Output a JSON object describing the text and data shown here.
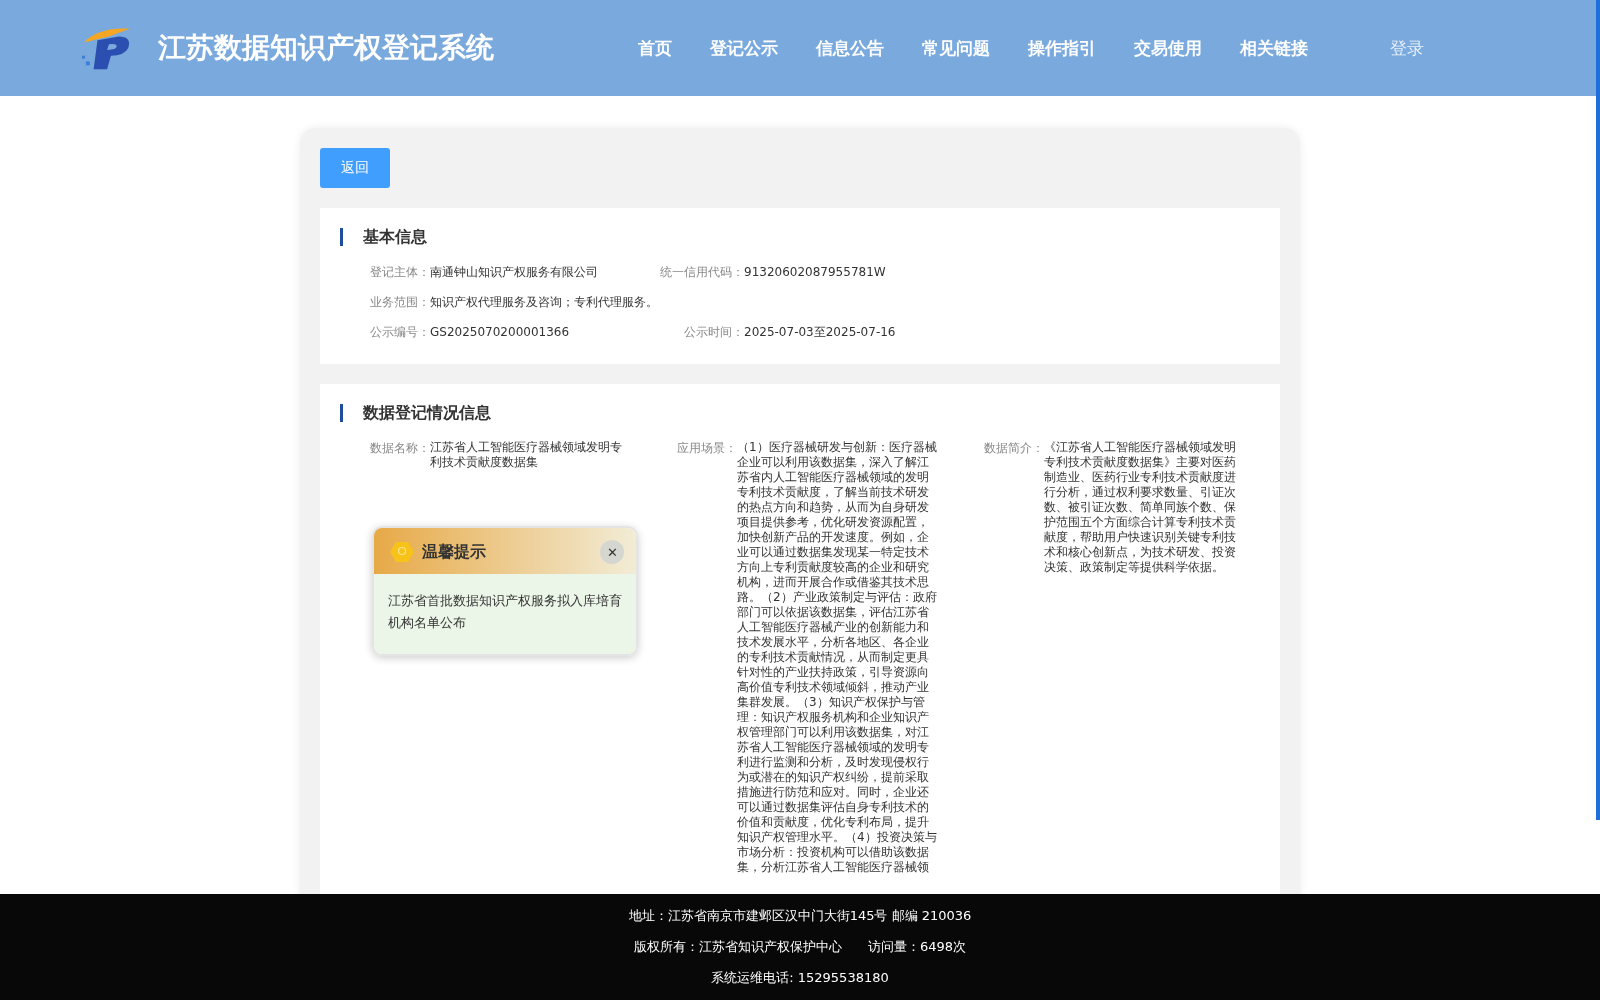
{
  "header": {
    "title": "江苏数据知识产权登记系统",
    "nav": [
      "首页",
      "登记公示",
      "信息公告",
      "常见问题",
      "操作指引",
      "交易使用",
      "相关链接"
    ],
    "login": "登录"
  },
  "back_button": "返回",
  "basic_info": {
    "title": "基本信息",
    "rows": [
      [
        {
          "label": "登记主体：",
          "value": "南通钟山知识产权服务有限公司"
        },
        {
          "label": "统一信用代码：",
          "value": "91320602087955781W"
        }
      ],
      [
        {
          "label": "业务范围：",
          "value": "知识产权代理服务及咨询；专利代理服务。"
        }
      ],
      [
        {
          "label": "公示编号：",
          "value": "GS2025070200001366"
        },
        {
          "label": "公示时间：",
          "value": "2025-07-03至2025-07-16"
        }
      ]
    ]
  },
  "data_info": {
    "title": "数据登记情况信息",
    "fields": [
      {
        "label": "数据名称：",
        "value": "江苏省人工智能医疗器械领域发明专利技术贡献度数据集"
      },
      {
        "label": "应用场景：",
        "value": "（1）医疗器械研发与创新：医疗器械企业可以利用该数据集，深入了解江苏省内人工智能医疗器械领域的发明专利技术贡献度，了解当前技术研发的热点方向和趋势，从而为自身研发项目提供参考，优化研发资源配置，加快创新产品的开发速度。例如，企业可以通过数据集发现某一特定技术方向上专利贡献度较高的企业和研究机构，进而开展合作或借鉴其技术思路。（2）产业政策制定与评估：政府部门可以依据该数据集，评估江苏省人工智能医疗器械产业的创新能力和技术发展水平，分析各地区、各企业的专利技术贡献情况，从而制定更具针对性的产业扶持政策，引导资源向高价值专利技术领域倾斜，推动产业集群发展。（3）知识产权保护与管理：知识产权服务机构和企业知识产权管理部门可以利用该数据集，对江苏省人工智能医疗器械领域的发明专利进行监测和分析，及时发现侵权行为或潜在的知识产权纠纷，提前采取措施进行防范和应对。同时，企业还可以通过数据集评估自身专利技术的价值和贡献度，优化专利布局，提升知识产权管理水平。（4）投资决策与市场分析：投资机构可以借助该数据集，分析江苏省人工智能医疗器械领"
      },
      {
        "label": "数据简介：",
        "value": "《江苏省人工智能医疗器械领域发明专利技术贡献度数据集》主要对医药制造业、医药行业专利技术贡献度进行分析，通过权利要求数量、引证次数、被引证次数、简单同族个数、保护范围五个方面综合计算专利技术贡献度，帮助用户快速识别关键专利技术和核心创新点，为技术研发、投资决策、政策制定等提供科学依据。"
      }
    ]
  },
  "notice": {
    "title": "温馨提示",
    "close": "✕",
    "message": "江苏省首批数据知识产权服务拟入库培育机构名单公布"
  },
  "footer": [
    "地址：江苏省南京市建邺区汉中门大街145号 邮编 210036",
    "版权所有：江苏省知识产权保护中心　　访问量：6498次",
    "系统运维电话: 15295538180"
  ]
}
